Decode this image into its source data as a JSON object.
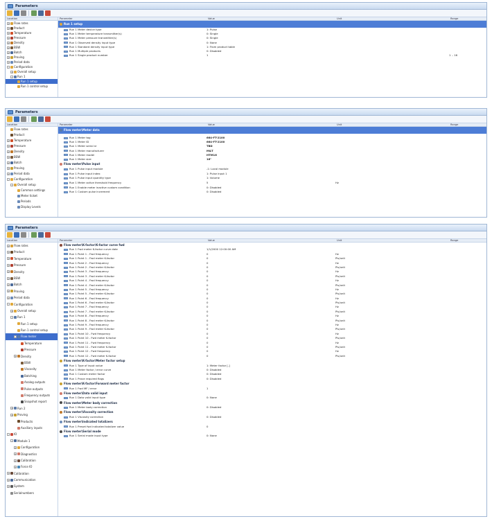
{
  "window": {
    "title": "Parameters"
  },
  "columns": {
    "location": "Location",
    "parameter": "Parameter",
    "value": "Value",
    "unit": "Unit",
    "range": "Range"
  },
  "colors": {
    "selection": "#3d6dcc",
    "banner": "#4d7dd6",
    "titlebar": "#c9daf0"
  },
  "panel1": {
    "tree": [
      {
        "label": "Flow rates",
        "indent": 0,
        "exp": "+",
        "icon": "flow-rates-icon",
        "color": "#d9a23a"
      },
      {
        "label": "Product",
        "indent": 0,
        "exp": "+",
        "icon": "product-icon",
        "color": "#6b4a2a"
      },
      {
        "label": "Temperature",
        "indent": 0,
        "exp": "+",
        "icon": "temperature-icon",
        "color": "#d0502a"
      },
      {
        "label": "Pressure",
        "indent": 0,
        "exp": "+",
        "icon": "pressure-icon",
        "color": "#b04030"
      },
      {
        "label": "Density",
        "indent": 0,
        "exp": "+",
        "icon": "density-icon",
        "color": "#c0782a"
      },
      {
        "label": "BSW",
        "indent": 0,
        "exp": "+",
        "icon": "bsw-icon",
        "color": "#7a5a3a"
      },
      {
        "label": "Batch",
        "indent": 0,
        "exp": "+",
        "icon": "batch-icon",
        "color": "#4a6a9a"
      },
      {
        "label": "Proving",
        "indent": 0,
        "exp": "+",
        "icon": "proving-icon",
        "color": "#c8a030"
      },
      {
        "label": "Period data",
        "indent": 0,
        "exp": "+",
        "icon": "period-data-icon",
        "color": "#6a8ab8"
      },
      {
        "label": "Configuration",
        "indent": 0,
        "exp": "-",
        "icon": "configuration-icon",
        "color": "#e0a83a"
      },
      {
        "label": "Overall setup",
        "indent": 1,
        "exp": "+",
        "icon": "overall-setup-icon",
        "color": "#e0a83a"
      },
      {
        "label": "Run 1",
        "indent": 1,
        "exp": "-",
        "icon": "run-icon",
        "color": "#5a7aa8"
      },
      {
        "label": "Run 1 setup",
        "indent": 2,
        "exp": "",
        "icon": "run-setup-icon",
        "color": "#e0a83a",
        "selected": true
      },
      {
        "label": "Run 1 control setup",
        "indent": 2,
        "exp": "",
        "icon": "run-control-setup-icon",
        "color": "#e0a83a"
      }
    ],
    "banner": "Run 1 setup",
    "rows": [
      {
        "param": "Run 1 Meter device type",
        "value": "1: Pulse",
        "unit": "",
        "range": ""
      },
      {
        "param": "Run 1 Meter temperature transmitter(s)",
        "value": "0: Single",
        "unit": "",
        "range": ""
      },
      {
        "param": "Run 1 Meter pressure transmitter(s)",
        "value": "0: Single",
        "unit": "",
        "range": ""
      },
      {
        "param": "Run 1 Observed density input type",
        "value": "0: None",
        "unit": "",
        "range": ""
      },
      {
        "param": "Run 1 Standard density input type",
        "value": "1: From product table",
        "unit": "",
        "range": ""
      },
      {
        "param": "Run 1 Multiple products",
        "value": "0: Disabled",
        "unit": "",
        "range": ""
      },
      {
        "param": "Run 1 Single product number",
        "value": "1",
        "unit": "",
        "range": "1 .. 16"
      }
    ]
  },
  "panel2": {
    "tree": [
      {
        "label": "Flow rates",
        "indent": 0,
        "exp": "",
        "icon": "flow-rates-icon",
        "color": "#d9a23a"
      },
      {
        "label": "Product",
        "indent": 0,
        "exp": "",
        "icon": "product-icon",
        "color": "#6b4a2a"
      },
      {
        "label": "Temperature",
        "indent": 0,
        "exp": "+",
        "icon": "temperature-icon",
        "color": "#d0502a"
      },
      {
        "label": "Pressure",
        "indent": 0,
        "exp": "+",
        "icon": "pressure-icon",
        "color": "#b04030"
      },
      {
        "label": "Density",
        "indent": 0,
        "exp": "+",
        "icon": "density-icon",
        "color": "#c0782a"
      },
      {
        "label": "BSW",
        "indent": 0,
        "exp": "+",
        "icon": "bsw-icon",
        "color": "#7a5a3a"
      },
      {
        "label": "Batch",
        "indent": 0,
        "exp": "+",
        "icon": "batch-icon",
        "color": "#4a6a9a"
      },
      {
        "label": "Proving",
        "indent": 0,
        "exp": "+",
        "icon": "proving-icon",
        "color": "#c8a030"
      },
      {
        "label": "Period data",
        "indent": 0,
        "exp": "+",
        "icon": "period-data-icon",
        "color": "#6a8ab8"
      },
      {
        "label": "Configuration",
        "indent": 0,
        "exp": "-",
        "icon": "configuration-icon",
        "color": "#e0a83a"
      },
      {
        "label": "Overall setup",
        "indent": 1,
        "exp": "-",
        "icon": "overall-setup-icon",
        "color": "#e0a83a"
      },
      {
        "label": "Common settings",
        "indent": 2,
        "exp": "",
        "icon": "common-settings-icon",
        "color": "#e0a83a"
      },
      {
        "label": "Meter ticket",
        "indent": 2,
        "exp": "",
        "icon": "meter-ticket-icon",
        "color": "#6a8ab8"
      },
      {
        "label": "Periods",
        "indent": 2,
        "exp": "",
        "icon": "periods-icon",
        "color": "#6a8ab8"
      },
      {
        "label": "Display Levels",
        "indent": 2,
        "exp": "",
        "icon": "display-levels-icon",
        "color": "#6a8ab8"
      }
    ],
    "banner": "Flow meter\\Meter data",
    "rows": [
      {
        "param": "Run 1 Meter tag",
        "value": "664-FT-2100",
        "unit": "",
        "range": "",
        "bold": true
      },
      {
        "param": "Run 1 Meter ID",
        "value": "664-FT-2100",
        "unit": "",
        "range": "",
        "bold": true
      },
      {
        "param": "Run 1 Meter serial nr",
        "value": "TBD",
        "unit": "",
        "range": "",
        "bold": true
      },
      {
        "param": "Run 1 Meter manufacturer",
        "value": "M&T",
        "unit": "",
        "range": "",
        "bold": true
      },
      {
        "param": "Run 1 Meter model",
        "value": "HTM16",
        "unit": "",
        "range": "",
        "bold": true
      },
      {
        "param": "Run 1 Meter size",
        "value": "16\"",
        "unit": "",
        "range": "",
        "bold": true
      }
    ],
    "section2": "Flow meter\\Pulse input",
    "rows2": [
      {
        "param": "Run 1 Pulse input module",
        "value": "-1: Local module",
        "unit": "",
        "range": ""
      },
      {
        "param": "Run 1 Pulse input index",
        "value": "1: Pulse input 1",
        "unit": "",
        "range": ""
      },
      {
        "param": "Run 1 Pulse input quantity type",
        "value": "1: Volume",
        "unit": "",
        "range": ""
      },
      {
        "param": "Run 1 Meter active threshold frequency",
        "value": "5",
        "unit": "Hz",
        "range": ""
      },
      {
        "param": "Run 1 Enable meter inactive custom condition",
        "value": "0: Disabled",
        "unit": "",
        "range": ""
      },
      {
        "param": "Run 1 Custom pulse increment",
        "value": "0: Disabled",
        "unit": "",
        "range": ""
      }
    ]
  },
  "panel3": {
    "tree": [
      {
        "label": "Flow rates",
        "indent": 0,
        "exp": "+",
        "icon": "flow-rates-icon",
        "color": "#d9a23a"
      },
      {
        "label": "Product",
        "indent": 0,
        "exp": "+",
        "icon": "product-icon",
        "color": "#6b4a2a"
      },
      {
        "label": "Temperature",
        "indent": 0,
        "exp": "+",
        "icon": "temperature-icon",
        "color": "#d0502a"
      },
      {
        "label": "Pressure",
        "indent": 0,
        "exp": "+",
        "icon": "pressure-icon",
        "color": "#b04030"
      },
      {
        "label": "Density",
        "indent": 0,
        "exp": "+",
        "icon": "density-icon",
        "color": "#c0782a"
      },
      {
        "label": "BSW",
        "indent": 0,
        "exp": "+",
        "icon": "bsw-icon",
        "color": "#7a5a3a"
      },
      {
        "label": "Batch",
        "indent": 0,
        "exp": "+",
        "icon": "batch-icon",
        "color": "#4a6a9a"
      },
      {
        "label": "Proving",
        "indent": 0,
        "exp": "+",
        "icon": "proving-icon",
        "color": "#c8a030"
      },
      {
        "label": "Period data",
        "indent": 0,
        "exp": "+",
        "icon": "period-data-icon",
        "color": "#6a8ab8"
      },
      {
        "label": "Configuration",
        "indent": 0,
        "exp": "-",
        "icon": "configuration-icon",
        "color": "#e0a83a"
      },
      {
        "label": "Overall setup",
        "indent": 1,
        "exp": "+",
        "icon": "overall-setup-icon",
        "color": "#e0a83a"
      },
      {
        "label": "Run 1",
        "indent": 1,
        "exp": "-",
        "icon": "run-icon",
        "color": "#5a7aa8"
      },
      {
        "label": "Run 1 setup",
        "indent": 2,
        "exp": "",
        "icon": "run-setup-icon",
        "color": "#e0a83a"
      },
      {
        "label": "Run 1 control setup",
        "indent": 2,
        "exp": "",
        "icon": "run-control-setup-icon",
        "color": "#e0a83a"
      },
      {
        "label": "Flow meter",
        "indent": 2,
        "exp": "-",
        "icon": "flow-meter-icon",
        "color": "#5a7aa8",
        "selected": true
      },
      {
        "label": "Temperature",
        "indent": 3,
        "exp": "",
        "icon": "temperature-icon",
        "color": "#d0502a"
      },
      {
        "label": "Pressure",
        "indent": 3,
        "exp": "",
        "icon": "pressure-icon",
        "color": "#b04030"
      },
      {
        "label": "Density",
        "indent": 2,
        "exp": "+",
        "icon": "density-icon",
        "color": "#c0782a"
      },
      {
        "label": "BSW",
        "indent": 3,
        "exp": "",
        "icon": "bsw-icon",
        "color": "#7a5a3a"
      },
      {
        "label": "Viscosity",
        "indent": 3,
        "exp": "",
        "icon": "viscosity-icon",
        "color": "#c0782a"
      },
      {
        "label": "Batching",
        "indent": 3,
        "exp": "",
        "icon": "batching-icon",
        "color": "#4a6a9a"
      },
      {
        "label": "Analog outputs",
        "indent": 3,
        "exp": "",
        "icon": "analog-outputs-icon",
        "color": "#d07a6a"
      },
      {
        "label": "Pulse outputs",
        "indent": 3,
        "exp": "",
        "icon": "pulse-outputs-icon",
        "color": "#d07a6a"
      },
      {
        "label": "Frequency outputs",
        "indent": 3,
        "exp": "",
        "icon": "frequency-outputs-icon",
        "color": "#d07a6a"
      },
      {
        "label": "Snapshot report",
        "indent": 3,
        "exp": "",
        "icon": "snapshot-report-icon",
        "color": "#4a4a4a"
      },
      {
        "label": "Run 2",
        "indent": 1,
        "exp": "+",
        "icon": "run-icon",
        "color": "#5a7aa8"
      },
      {
        "label": "Proving",
        "indent": 1,
        "exp": "+",
        "icon": "proving-icon",
        "color": "#c8a030"
      },
      {
        "label": "Products",
        "indent": 2,
        "exp": "",
        "icon": "products-icon",
        "color": "#6b4a2a"
      },
      {
        "label": "Auxiliary inputs",
        "indent": 2,
        "exp": "",
        "icon": "auxiliary-inputs-icon",
        "color": "#d07a6a"
      },
      {
        "label": "IO",
        "indent": 0,
        "exp": "-",
        "icon": "io-icon",
        "color": "#c84a3a"
      },
      {
        "label": "Module 1",
        "indent": 1,
        "exp": "-",
        "icon": "module-icon",
        "color": "#4a6a9a"
      },
      {
        "label": "Configuration",
        "indent": 2,
        "exp": "+",
        "icon": "configuration-icon",
        "color": "#e0a83a"
      },
      {
        "label": "Diagnostics",
        "indent": 2,
        "exp": "+",
        "icon": "diagnostics-icon",
        "color": "#d07a6a"
      },
      {
        "label": "Calibration",
        "indent": 2,
        "exp": "+",
        "icon": "calibration-icon",
        "color": "#6a4a3a"
      },
      {
        "label": "Force IO",
        "indent": 2,
        "exp": "+",
        "icon": "force-io-icon",
        "color": "#4a8ab8"
      },
      {
        "label": "Calibration",
        "indent": 0,
        "exp": "+",
        "icon": "calibration-icon",
        "color": "#6a4a3a"
      },
      {
        "label": "Communication",
        "indent": 0,
        "exp": "+",
        "icon": "communication-icon",
        "color": "#4a6a9a"
      },
      {
        "label": "System",
        "indent": 0,
        "exp": "+",
        "icon": "system-icon",
        "color": "#5a5a5a"
      },
      {
        "label": "Serialnumbers",
        "indent": 0,
        "exp": "",
        "icon": "serialnumbers-icon",
        "color": "#8a8a8a"
      }
    ],
    "sections": [
      {
        "title": "Flow meter\\K-factor\\K-factor curve fwd",
        "icon": "k-factor-curve-icon",
        "color": "#8a4a3a",
        "rows": [
          {
            "param": "Run 1 Fwd meter K-factor curve date",
            "value": "1/1/2000 12:00:00 AM",
            "unit": ""
          },
          {
            "param": "Run 1 Point 1 - Fwd frequency",
            "value": "0",
            "unit": "Hz"
          },
          {
            "param": "Run 1 Point 1 - Fwd meter K-factor",
            "value": "0",
            "unit": "Pls/unit"
          },
          {
            "param": "Run 1 Point 2 - Fwd frequency",
            "value": "0",
            "unit": "Hz"
          },
          {
            "param": "Run 1 Point 2 - Fwd meter K-factor",
            "value": "0",
            "unit": "Pls/unit"
          },
          {
            "param": "Run 1 Point 3 - Fwd frequency",
            "value": "0",
            "unit": "Hz"
          },
          {
            "param": "Run 1 Point 3 - Fwd meter K-factor",
            "value": "0",
            "unit": "Pls/unit"
          },
          {
            "param": "Run 1 Point 4 - Fwd frequency",
            "value": "0",
            "unit": "Hz"
          },
          {
            "param": "Run 1 Point 4 - Fwd meter K-factor",
            "value": "0",
            "unit": "Pls/unit"
          },
          {
            "param": "Run 1 Point 5 - Fwd frequency",
            "value": "0",
            "unit": "Hz"
          },
          {
            "param": "Run 1 Point 5 - Fwd meter K-factor",
            "value": "0",
            "unit": "Pls/unit"
          },
          {
            "param": "Run 1 Point 6 - Fwd frequency",
            "value": "0",
            "unit": "Hz"
          },
          {
            "param": "Run 1 Point 6 - Fwd meter K-factor",
            "value": "0",
            "unit": "Pls/unit"
          },
          {
            "param": "Run 1 Point 7 - Fwd frequency",
            "value": "0",
            "unit": "Hz"
          },
          {
            "param": "Run 1 Point 7 - Fwd meter K-factor",
            "value": "0",
            "unit": "Pls/unit"
          },
          {
            "param": "Run 1 Point 8 - Fwd frequency",
            "value": "0",
            "unit": "Hz"
          },
          {
            "param": "Run 1 Point 8 - Fwd meter K-factor",
            "value": "0",
            "unit": "Pls/unit"
          },
          {
            "param": "Run 1 Point 9 - Fwd frequency",
            "value": "0",
            "unit": "Hz"
          },
          {
            "param": "Run 1 Point 9 - Fwd meter K-factor",
            "value": "0",
            "unit": "Pls/unit"
          },
          {
            "param": "Run 1 Point 10 - Fwd frequency",
            "value": "0",
            "unit": "Hz"
          },
          {
            "param": "Run 1 Point 10 - Fwd meter K-factor",
            "value": "0",
            "unit": "Pls/unit"
          },
          {
            "param": "Run 1 Point 11 - Fwd frequency",
            "value": "0",
            "unit": "Hz"
          },
          {
            "param": "Run 1 Point 11 - Fwd meter K-factor",
            "value": "0",
            "unit": "Pls/unit"
          },
          {
            "param": "Run 1 Point 12 - Fwd frequency",
            "value": "0",
            "unit": "Hz"
          },
          {
            "param": "Run 1 Point 12 - Fwd meter K-factor",
            "value": "0",
            "unit": "Pls/unit"
          }
        ]
      },
      {
        "title": "Flow meter\\K-factor\\Meter factor setup",
        "icon": "meter-factor-setup-icon",
        "color": "#c8a030",
        "rows": [
          {
            "param": "Run 1 Type of input value",
            "value": "1: Meter factor [-]",
            "unit": ""
          },
          {
            "param": "Run 1 Meter factor / error curve",
            "value": "0: Disabled",
            "unit": ""
          },
          {
            "param": "Run 1 Custom meter factor",
            "value": "0: Disabled",
            "unit": ""
          },
          {
            "param": "Run 1 Prove required flags",
            "value": "0: Disabled",
            "unit": ""
          }
        ]
      },
      {
        "title": "Flow meter\\K-factor\\Forward meter factor",
        "icon": "forward-meter-factor-icon",
        "color": "#c8a030",
        "rows": [
          {
            "param": "Run 1 Fwd MF / error",
            "value": "1",
            "unit": ""
          }
        ]
      },
      {
        "title": "Flow meter\\Data valid input",
        "icon": "data-valid-input-icon",
        "color": "#d07a6a",
        "rows": [
          {
            "param": "Run 1 Data valid input type",
            "value": "0: None",
            "unit": ""
          }
        ]
      },
      {
        "title": "Flow meter\\Meter body correction",
        "icon": "meter-body-correction-icon",
        "color": "#4a4a4a",
        "rows": [
          {
            "param": "Run 1 Meter body correction",
            "value": "0: Disabled",
            "unit": ""
          }
        ]
      },
      {
        "title": "Flow meter\\Viscosity correction",
        "icon": "viscosity-correction-icon",
        "color": "#c0782a",
        "rows": [
          {
            "param": "Run 1 Viscosity correction",
            "value": "0: Disabled",
            "unit": ""
          }
        ]
      },
      {
        "title": "Flow meter\\Indicated totalizers",
        "icon": "indicated-totalizers-icon",
        "color": "#6a8ab8",
        "rows": [
          {
            "param": "Run 1 Preset fwd indicated totalizer value",
            "value": "0",
            "unit": ""
          }
        ]
      },
      {
        "title": "Flow meter\\Serial mode",
        "icon": "serial-mode-icon",
        "color": "#4a4a4a",
        "rows": [
          {
            "param": "Run 1 Serial mode input type",
            "value": "0: None",
            "unit": ""
          }
        ]
      }
    ]
  }
}
